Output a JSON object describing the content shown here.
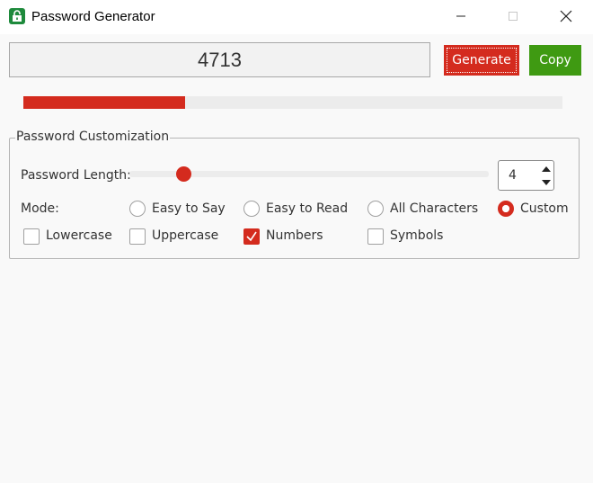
{
  "window": {
    "title": "Password Generator",
    "icon": "lock-icon"
  },
  "password": {
    "value": "4713"
  },
  "buttons": {
    "generate_label": "Generate",
    "copy_label": "Copy"
  },
  "strength": {
    "fraction": 0.3,
    "color": "#d42b1e"
  },
  "customization": {
    "title": "Password Customization",
    "length_label": "Password Length:",
    "length_value": "4",
    "length_min": 1,
    "length_max": 21,
    "mode_label": "Mode:",
    "modes": [
      {
        "label": "Easy to Say",
        "selected": false
      },
      {
        "label": "Easy to Read",
        "selected": false
      },
      {
        "label": "All Characters",
        "selected": false
      },
      {
        "label": "Custom",
        "selected": true
      }
    ],
    "charsets": [
      {
        "label": "Lowercase",
        "checked": false
      },
      {
        "label": "Uppercase",
        "checked": false
      },
      {
        "label": "Numbers",
        "checked": true
      },
      {
        "label": "Symbols",
        "checked": false
      }
    ]
  },
  "colors": {
    "accent": "#d42b1e",
    "copy": "#3f9a12",
    "icon": "#1e8a3c"
  }
}
